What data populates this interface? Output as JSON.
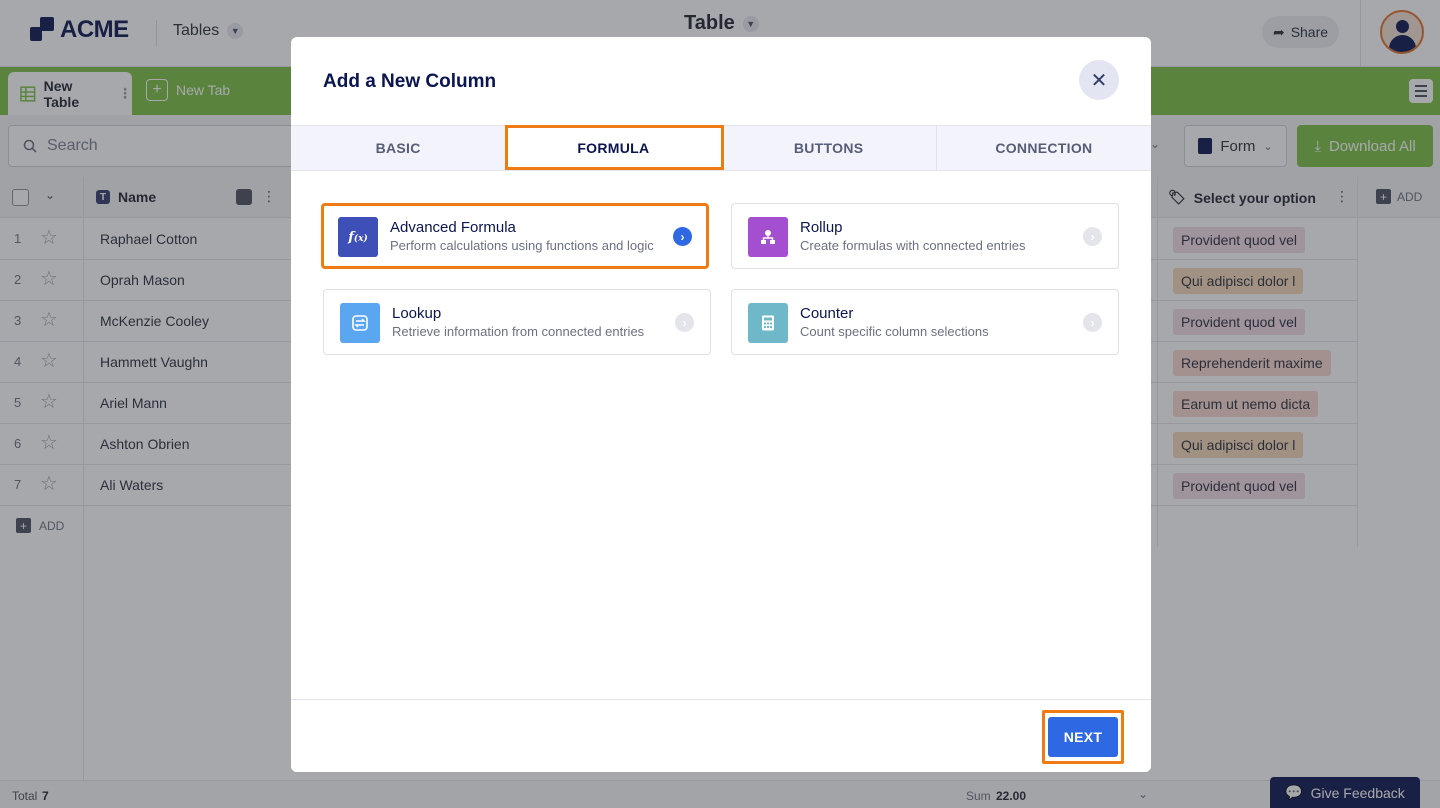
{
  "app": {
    "logo_text": "ACME",
    "nav_label": "Tables",
    "page_title": "Table",
    "share_label": "Share"
  },
  "tabs_bar": {
    "active_tab": "New Table",
    "new_tab": "New Tab"
  },
  "toolbar": {
    "search_placeholder": "Search",
    "form_label": "Form",
    "download_label": "Download All"
  },
  "grid": {
    "columns": {
      "name": "Name",
      "select": "Select your option",
      "add": "ADD"
    },
    "rows": [
      {
        "num": "1",
        "name": "Raphael Cotton",
        "option": "Provident quod vel",
        "chip_color": "#f2dbe6"
      },
      {
        "num": "2",
        "name": "Oprah Mason",
        "option": "Qui adipisci dolor l",
        "chip_color": "#f5d7b8"
      },
      {
        "num": "3",
        "name": "McKenzie Cooley",
        "option": "Provident quod vel",
        "chip_color": "#f2dbe6"
      },
      {
        "num": "4",
        "name": "Hammett Vaughn",
        "option": "Reprehenderit maxime",
        "chip_color": "#f7d8cf"
      },
      {
        "num": "5",
        "name": "Ariel Mann",
        "option": "Earum ut nemo dicta",
        "chip_color": "#f7d8cf"
      },
      {
        "num": "6",
        "name": "Ashton Obrien",
        "option": "Qui adipisci dolor l",
        "chip_color": "#f5d7b8"
      },
      {
        "num": "7",
        "name": "Ali Waters",
        "option": "Provident quod vel",
        "chip_color": "#f2dbe6"
      }
    ],
    "add_row_label": "ADD"
  },
  "footer": {
    "total_label": "Total",
    "total_value": "7",
    "sum_label": "Sum",
    "sum_value": "22.00",
    "feedback_label": "Give Feedback"
  },
  "modal": {
    "title": "Add a New Column",
    "tabs": [
      "BASIC",
      "FORMULA",
      "BUTTONS",
      "CONNECTION"
    ],
    "active_tab": "FORMULA",
    "options": [
      {
        "title": "Advanced Formula",
        "desc": "Perform calculations using functions and logic",
        "icon": "function-icon",
        "color": "#3e4fb8",
        "selected": true
      },
      {
        "title": "Rollup",
        "desc": "Create formulas with connected entries",
        "icon": "hierarchy-icon",
        "color": "#a44fcf",
        "selected": false
      },
      {
        "title": "Lookup",
        "desc": "Retrieve information from connected entries",
        "icon": "lookup-icon",
        "color": "#5ba6f0",
        "selected": false
      },
      {
        "title": "Counter",
        "desc": "Count specific column selections",
        "icon": "calculator-icon",
        "color": "#6fb8c9",
        "selected": false
      }
    ],
    "next_label": "NEXT"
  },
  "colors": {
    "accent_blue": "#2e69e3",
    "highlight_orange": "#f07b12",
    "brand_green": "#7ac142",
    "navy": "#0a1551"
  }
}
